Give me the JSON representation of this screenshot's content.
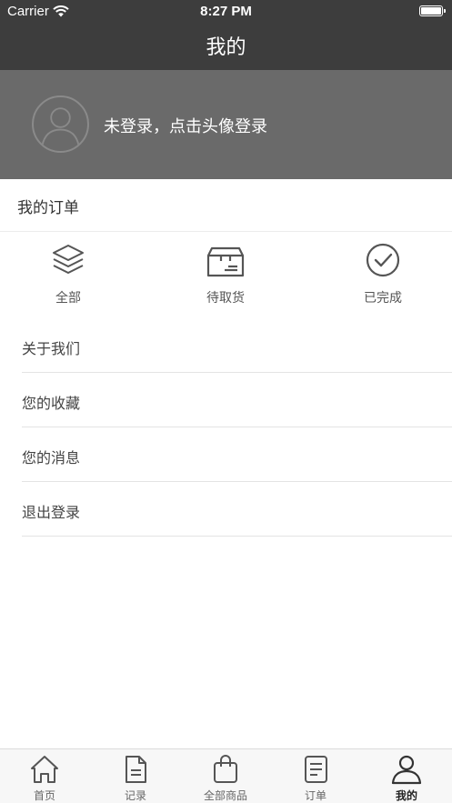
{
  "status_bar": {
    "carrier": "Carrier",
    "time": "8:27 PM"
  },
  "nav": {
    "title": "我的"
  },
  "profile": {
    "login_prompt": "未登录，点击头像登录"
  },
  "orders": {
    "title": "我的订单",
    "items": [
      {
        "label": "全部",
        "icon": "layers-icon"
      },
      {
        "label": "待取货",
        "icon": "box-icon"
      },
      {
        "label": "已完成",
        "icon": "check-circle-icon"
      }
    ]
  },
  "menu": [
    {
      "label": "关于我们"
    },
    {
      "label": "您的收藏"
    },
    {
      "label": "您的消息"
    },
    {
      "label": "退出登录"
    }
  ],
  "tabbar": {
    "active_index": 4,
    "tabs": [
      {
        "label": "首页",
        "icon": "home-icon"
      },
      {
        "label": "记录",
        "icon": "document-icon"
      },
      {
        "label": "全部商品",
        "icon": "bag-icon"
      },
      {
        "label": "订单",
        "icon": "list-icon"
      },
      {
        "label": "我的",
        "icon": "user-icon"
      }
    ]
  },
  "colors": {
    "header": "#3d3d3d",
    "profile_bg": "#6a6a6a",
    "tabbar_bg": "#f7f7f7"
  }
}
